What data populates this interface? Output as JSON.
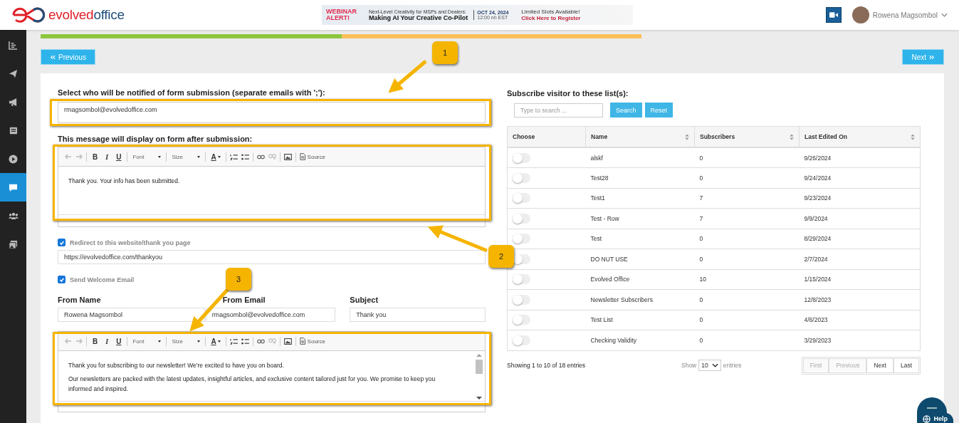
{
  "header": {
    "brand_first": "evolved",
    "brand_second": "office",
    "banner": {
      "alert": "WEBINAR ALERT!",
      "kicker": "Next-Level Creativity for MSPs and Dealers:",
      "headline": "Making AI Your Creative Co-Pilot",
      "date": "OCT 24, 2024",
      "time": "12:00 nn EST",
      "slots": "Limited Slots Available!",
      "cta": "Click Here to Register"
    },
    "user_name": "Rowena Magsombol"
  },
  "sidebar": {
    "items": [
      {
        "kind": "chart",
        "selected": false
      },
      {
        "kind": "send",
        "selected": false
      },
      {
        "kind": "megaphone",
        "selected": false
      },
      {
        "kind": "newspaper",
        "selected": false
      },
      {
        "kind": "play",
        "selected": false
      },
      {
        "kind": "chat",
        "selected": true
      },
      {
        "kind": "people",
        "selected": false
      },
      {
        "kind": "images",
        "selected": false
      }
    ]
  },
  "progress": [
    {
      "color": "#8dc63f"
    },
    {
      "color": "#fbbf5b"
    }
  ],
  "nav": {
    "previous": "Previous",
    "next": "Next"
  },
  "form": {
    "notify_label": "Select who will be notified of form submission (separate emails with ';'):",
    "notify_value": "rmagsombol@evolvedoffice.com",
    "message_label": "This message will display on form after submission:",
    "message_editor": {
      "format_buttons": [
        "B",
        "I",
        "U"
      ],
      "font": "Font",
      "size": "Size",
      "color_letter": "A",
      "source": "Source",
      "paragraphs": [
        "Thank you. Your info has been submitted."
      ],
      "scrollbar": false
    },
    "redirect": {
      "label": "Redirect to this website/thank you page",
      "checked": true,
      "value": "https://evolvedoffice.com/thankyou"
    },
    "welcome": {
      "label": "Send Welcome Email",
      "checked": true
    },
    "fields": [
      {
        "label": "From Name",
        "value": "Rowena Magsombol"
      },
      {
        "label": "From Email",
        "value": "rmagsombol@evolvedoffice.com"
      },
      {
        "label": "Subject",
        "value": "Thank you"
      }
    ],
    "welcome_editor": {
      "format_buttons": [
        "B",
        "I",
        "U"
      ],
      "font": "Font",
      "size": "Size",
      "color_letter": "A",
      "source": "Source",
      "paragraphs": [
        "Thank you for subscribing to our newsletter! We're excited to have you on board.",
        "Our newsletters are packed with the latest updates, insightful articles, and exclusive content tailored just for you. We promise to keep you informed and inspired."
      ],
      "scrollbar": true
    }
  },
  "lists": {
    "title": "Subscribe visitor to these list(s):",
    "search_placeholder": "Type to search ...",
    "search_button": "Search",
    "reset_button": "Reset",
    "columns": [
      {
        "label": "Choose",
        "sortable": false
      },
      {
        "label": "Name",
        "sortable": true
      },
      {
        "label": "Subscribers",
        "sortable": true
      },
      {
        "label": "Last Edited On",
        "sortable": true
      }
    ],
    "rows": [
      {
        "on": false,
        "name": "alskf",
        "subscribers": "0",
        "edited": "9/26/2024"
      },
      {
        "on": false,
        "name": "Test28",
        "subscribers": "0",
        "edited": "9/24/2024"
      },
      {
        "on": false,
        "name": "Test1",
        "subscribers": "7",
        "edited": "9/23/2024"
      },
      {
        "on": false,
        "name": "Test - Row",
        "subscribers": "7",
        "edited": "9/9/2024"
      },
      {
        "on": false,
        "name": "Test",
        "subscribers": "0",
        "edited": "8/29/2024"
      },
      {
        "on": false,
        "name": "DO NUT USE",
        "subscribers": "0",
        "edited": "2/7/2024"
      },
      {
        "on": false,
        "name": "Evolved Office",
        "subscribers": "10",
        "edited": "1/15/2024"
      },
      {
        "on": false,
        "name": "Newsletter Subscribers",
        "subscribers": "0",
        "edited": "12/8/2023"
      },
      {
        "on": false,
        "name": "Test List",
        "subscribers": "0",
        "edited": "4/6/2023"
      },
      {
        "on": false,
        "name": "Checking Validity",
        "subscribers": "0",
        "edited": "3/29/2023"
      }
    ],
    "info": "Showing 1 to 10 of 18 entries",
    "show_label": "Show",
    "page_size": "10",
    "entries_label": "entries",
    "pagination": [
      {
        "label": "First",
        "disabled": true
      },
      {
        "label": "Previous",
        "disabled": true
      },
      {
        "label": "Next",
        "disabled": false
      },
      {
        "label": "Last",
        "disabled": false
      }
    ]
  },
  "callouts": [
    {
      "number": "1"
    },
    {
      "number": "2"
    },
    {
      "number": "3"
    }
  ],
  "help": {
    "label": "Help"
  }
}
